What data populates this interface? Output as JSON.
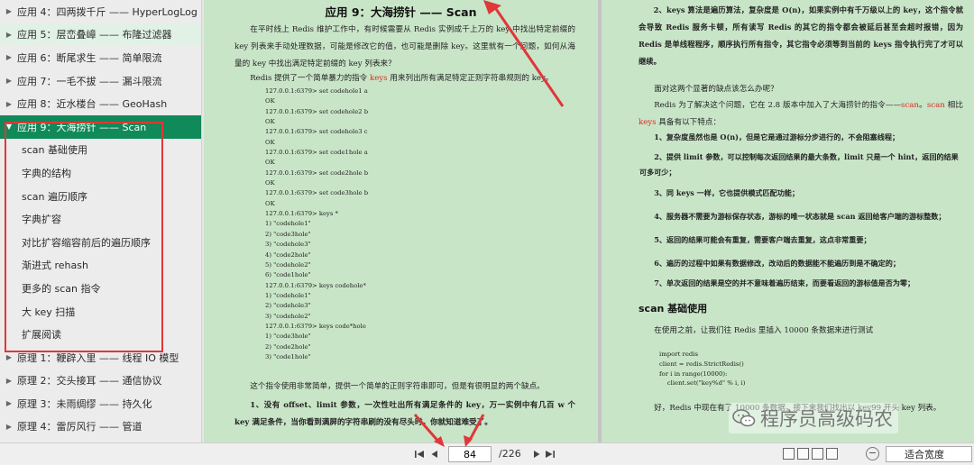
{
  "sidebar": {
    "items": [
      {
        "label": "应用 4：四两拨千斤 —— HyperLogLog",
        "level": 1,
        "state": ""
      },
      {
        "label": "应用 5：层峦叠嶂 —— 布隆过滤器",
        "level": 1,
        "state": "hl"
      },
      {
        "label": "应用 6：断尾求生 —— 简单限流",
        "level": 1,
        "state": ""
      },
      {
        "label": "应用 7：一毛不拔 —— 漏斗限流",
        "level": 1,
        "state": ""
      },
      {
        "label": "应用 8：近水楼台 —— GeoHash",
        "level": 1,
        "state": ""
      },
      {
        "label": "应用 9：大海捞针 —— Scan",
        "level": 1,
        "state": "sel",
        "expanded": true
      },
      {
        "label": "scan 基础使用",
        "level": 2,
        "state": ""
      },
      {
        "label": "字典的结构",
        "level": 2,
        "state": ""
      },
      {
        "label": "scan 遍历顺序",
        "level": 2,
        "state": ""
      },
      {
        "label": "字典扩容",
        "level": 2,
        "state": ""
      },
      {
        "label": "对比扩容缩容前后的遍历顺序",
        "level": 2,
        "state": ""
      },
      {
        "label": "渐进式 rehash",
        "level": 2,
        "state": ""
      },
      {
        "label": "更多的 scan 指令",
        "level": 2,
        "state": ""
      },
      {
        "label": "大 key 扫描",
        "level": 2,
        "state": ""
      },
      {
        "label": "扩展阅读",
        "level": 2,
        "state": ""
      },
      {
        "label": "原理 1：鞭辟入里 —— 线程 IO 模型",
        "level": 1,
        "state": ""
      },
      {
        "label": "原理 2：交头接耳 —— 通信协议",
        "level": 1,
        "state": ""
      },
      {
        "label": "原理 3：未雨绸缪 —— 持久化",
        "level": 1,
        "state": ""
      },
      {
        "label": "原理 4：雷厉风行 —— 管道",
        "level": 1,
        "state": ""
      }
    ]
  },
  "left_page": {
    "title": "应用 9：大海捞针 —— Scan",
    "para1": "在平时线上 Redis 维护工作中，有时候需要从 Redis 实例成千上万的 key 中找出特定前缀的 key 列表来手动处理数据，可能是修改它的值，也可能是删除 key。这里就有一个问题，如何从海量的 key 中找出满足特定前缀的 key 列表来？",
    "para2_pre": "Redis 提供了一个简单暴力的指令 ",
    "para2_keyword": "keys",
    "para2_post": " 用来列出所有满足特定正则字符串规则的 key。",
    "code": "127.0.0.1:6379> set codehole1 a\nOK\n127.0.0.1:6379> set codehole2 b\nOK\n127.0.0.1:6379> set codehole3 c\nOK\n127.0.0.1:6379> set code1hole a\nOK\n127.0.0.1:6379> set code2hole b\nOK\n127.0.0.1:6379> set code3hole b\nOK\n127.0.0.1:6379> keys *\n1) \"codehole1\"\n2) \"code3hole\"\n3) \"codehole3\"\n4) \"code2hole\"\n5) \"codehole2\"\n6) \"code1hole\"\n127.0.0.1:6379> keys codehole*\n1) \"codehole1\"\n2) \"codehole3\"\n3) \"codehole2\"\n127.0.0.1:6379> keys code*hole\n1) \"code3hole\"\n2) \"code2hole\"\n3) \"code1hole\"",
    "para3": "这个指令使用非常简单，提供一个简单的正则字符串即可，但是有很明显的两个缺点。",
    "para4": "1、没有 offset、limit 参数，一次性吐出所有满足条件的 key，万一实例中有几百 w 个 key 满足条件，当你看到满屏的字符串刷的没有尽头时，你就知道难受了。"
  },
  "right_page": {
    "p1": "2、keys 算法是遍历算法，复杂度是 O(n)，如果实例中有千万级以上的 key，这个指令就会导致 Redis 服务卡顿，所有读写 Redis 的其它的指令都会被延后甚至会超时报错，因为 Redis 是单线程程序，顺序执行所有指令，其它指令必须等到当前的 keys 指令执行完了才可以继续。",
    "p2": "面对这两个显著的缺点该怎么办呢？",
    "p3_pre": "Redis 为了解决这个问题，它在 2.8 版本中加入了大海捞针的指令——",
    "p3_kw1": "scan",
    "p3_mid": "。",
    "p3_kw2": "scan",
    "p3_post": " 相比 ",
    "p3_kw3": "keys",
    "p3_end": " 具备有以下特点：",
    "list": [
      "1、复杂度虽然也是 O(n)，但是它是通过游标分步进行的，不会阻塞线程；",
      "2、提供 limit 参数，可以控制每次返回结果的最大条数，limit 只是一个 hint，返回的结果可多可少；",
      "3、同 keys 一样，它也提供模式匹配功能；",
      "4、服务器不需要为游标保存状态，游标的唯一状态就是 scan 返回给客户端的游标整数；",
      "5、返回的结果可能会有重复，需要客户端去重复，这点非常重要；",
      "6、遍历的过程中如果有数据修改，改动后的数据能不能遍历到是不确定的；",
      "7、单次返回的结果是空的并不意味着遍历结束，而要看返回的游标值是否为零；"
    ],
    "heading": "scan 基础使用",
    "p4": "在使用之前，让我们往 Redis 里插入 10000 条数据来进行测试",
    "code": "import redis\nclient = redis.StrictRedis()\nfor i in range(10000):\n    client.set(\"key%d\" % i, i)",
    "p5": "好，Redis 中现在有了 10000 条数据，接下来我们找出以 key99 开头 key 列表。"
  },
  "watermark": {
    "text": "程序员高级码农"
  },
  "toolbar": {
    "page_number": "84",
    "page_total": "/226",
    "zoom_label": "适合宽度",
    "zoom_minus": "−"
  },
  "colors": {
    "accent": "#0f8a58",
    "annotation": "#e0373a",
    "page_bg": "#c9e5c8",
    "highlight_text": "#d62d20"
  },
  "icons": {
    "first": "first-page-icon",
    "prev": "prev-page-icon",
    "next": "next-page-icon",
    "last": "last-page-icon",
    "collapse": "collapse-arrow-icon",
    "expand": "expand-arrow-icon",
    "watermark": "wechat-icon"
  }
}
